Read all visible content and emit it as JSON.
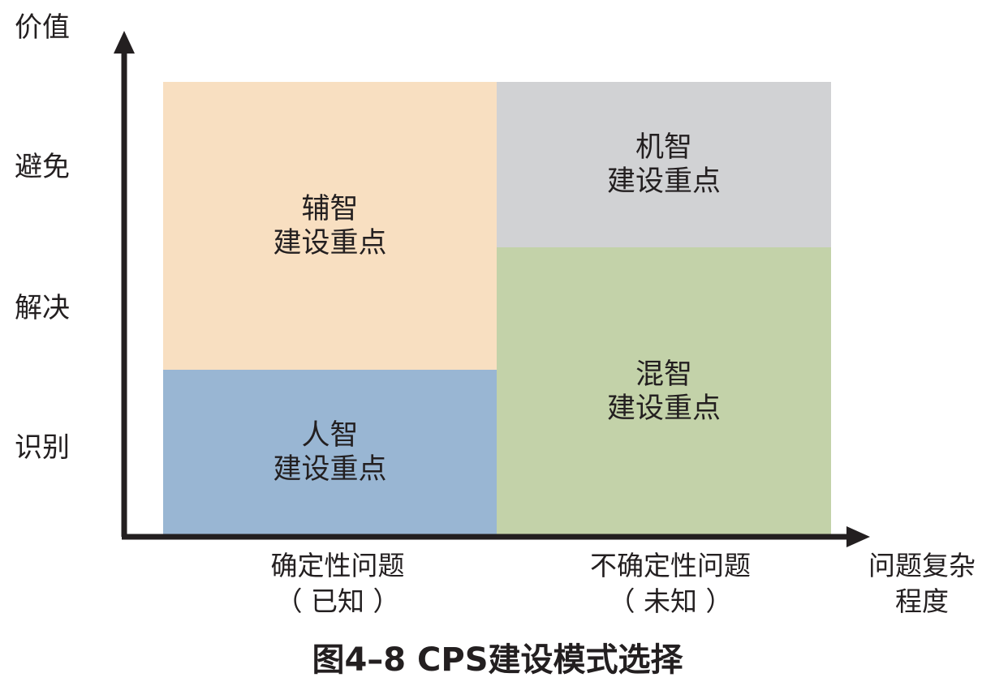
{
  "y_axis": {
    "title": "价值",
    "levels": [
      "避免",
      "解决",
      "识别"
    ]
  },
  "x_axis": {
    "title_line1": "问题复杂",
    "title_line2": "程度",
    "categories": [
      {
        "line1": "确定性问题",
        "line2": "（ 已知 ）"
      },
      {
        "line1": "不确定性问题",
        "line2": "（ 未知 ）"
      }
    ]
  },
  "quadrants": {
    "assist": {
      "line1": "辅智",
      "line2": "建设重点",
      "color": "#f8dfc1"
    },
    "human": {
      "line1": "人智",
      "line2": "建设重点",
      "color": "#99b6d3"
    },
    "machine": {
      "line1": "机智",
      "line2": "建设重点",
      "color": "#d1d2d4"
    },
    "hybrid": {
      "line1": "混智",
      "line2": "建设重点",
      "color": "#c3d2a9"
    }
  },
  "axis_color": "#231f20",
  "caption": "图4–8 CPS建设模式选择"
}
